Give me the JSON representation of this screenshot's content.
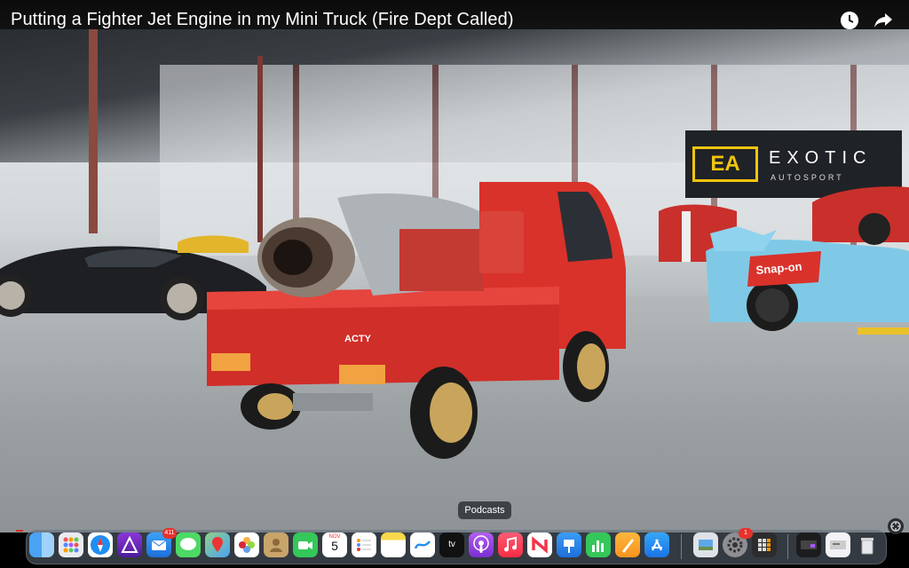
{
  "video": {
    "title": "Putting a Fighter Jet Engine in my Mini Truck (Fire Dept Called)"
  },
  "title_icons": [
    "clock-icon",
    "share-icon"
  ],
  "scene": {
    "sign_logo": "EA",
    "sign_line1": "EXOTIC",
    "sign_line2": "AUTOSPORT",
    "truck_badge": "ACTY",
    "sticker": "Snap-on"
  },
  "dock": {
    "tooltip": "Podcasts",
    "mail_badge": "411",
    "calendar_month": "NOV",
    "calendar_day": "5",
    "settings_badge": "1",
    "apps": [
      "Finder",
      "Launchpad",
      "Safari",
      "Affinity",
      "Mail",
      "Messages",
      "Maps",
      "Photos",
      "Contacts",
      "FaceTime",
      "Calendar",
      "Reminders",
      "Notes",
      "Freeform",
      "Apple TV",
      "Podcasts",
      "Music",
      "News",
      "Keynote",
      "Numbers",
      "Pages",
      "App Store",
      "Preview",
      "System Settings",
      "Calculator",
      "Screen",
      "Display",
      "Trash"
    ]
  },
  "colors": {
    "truck_red": "#d9322b",
    "sign_yellow": "#f1c40f",
    "dock_bg": "#5f6976"
  }
}
